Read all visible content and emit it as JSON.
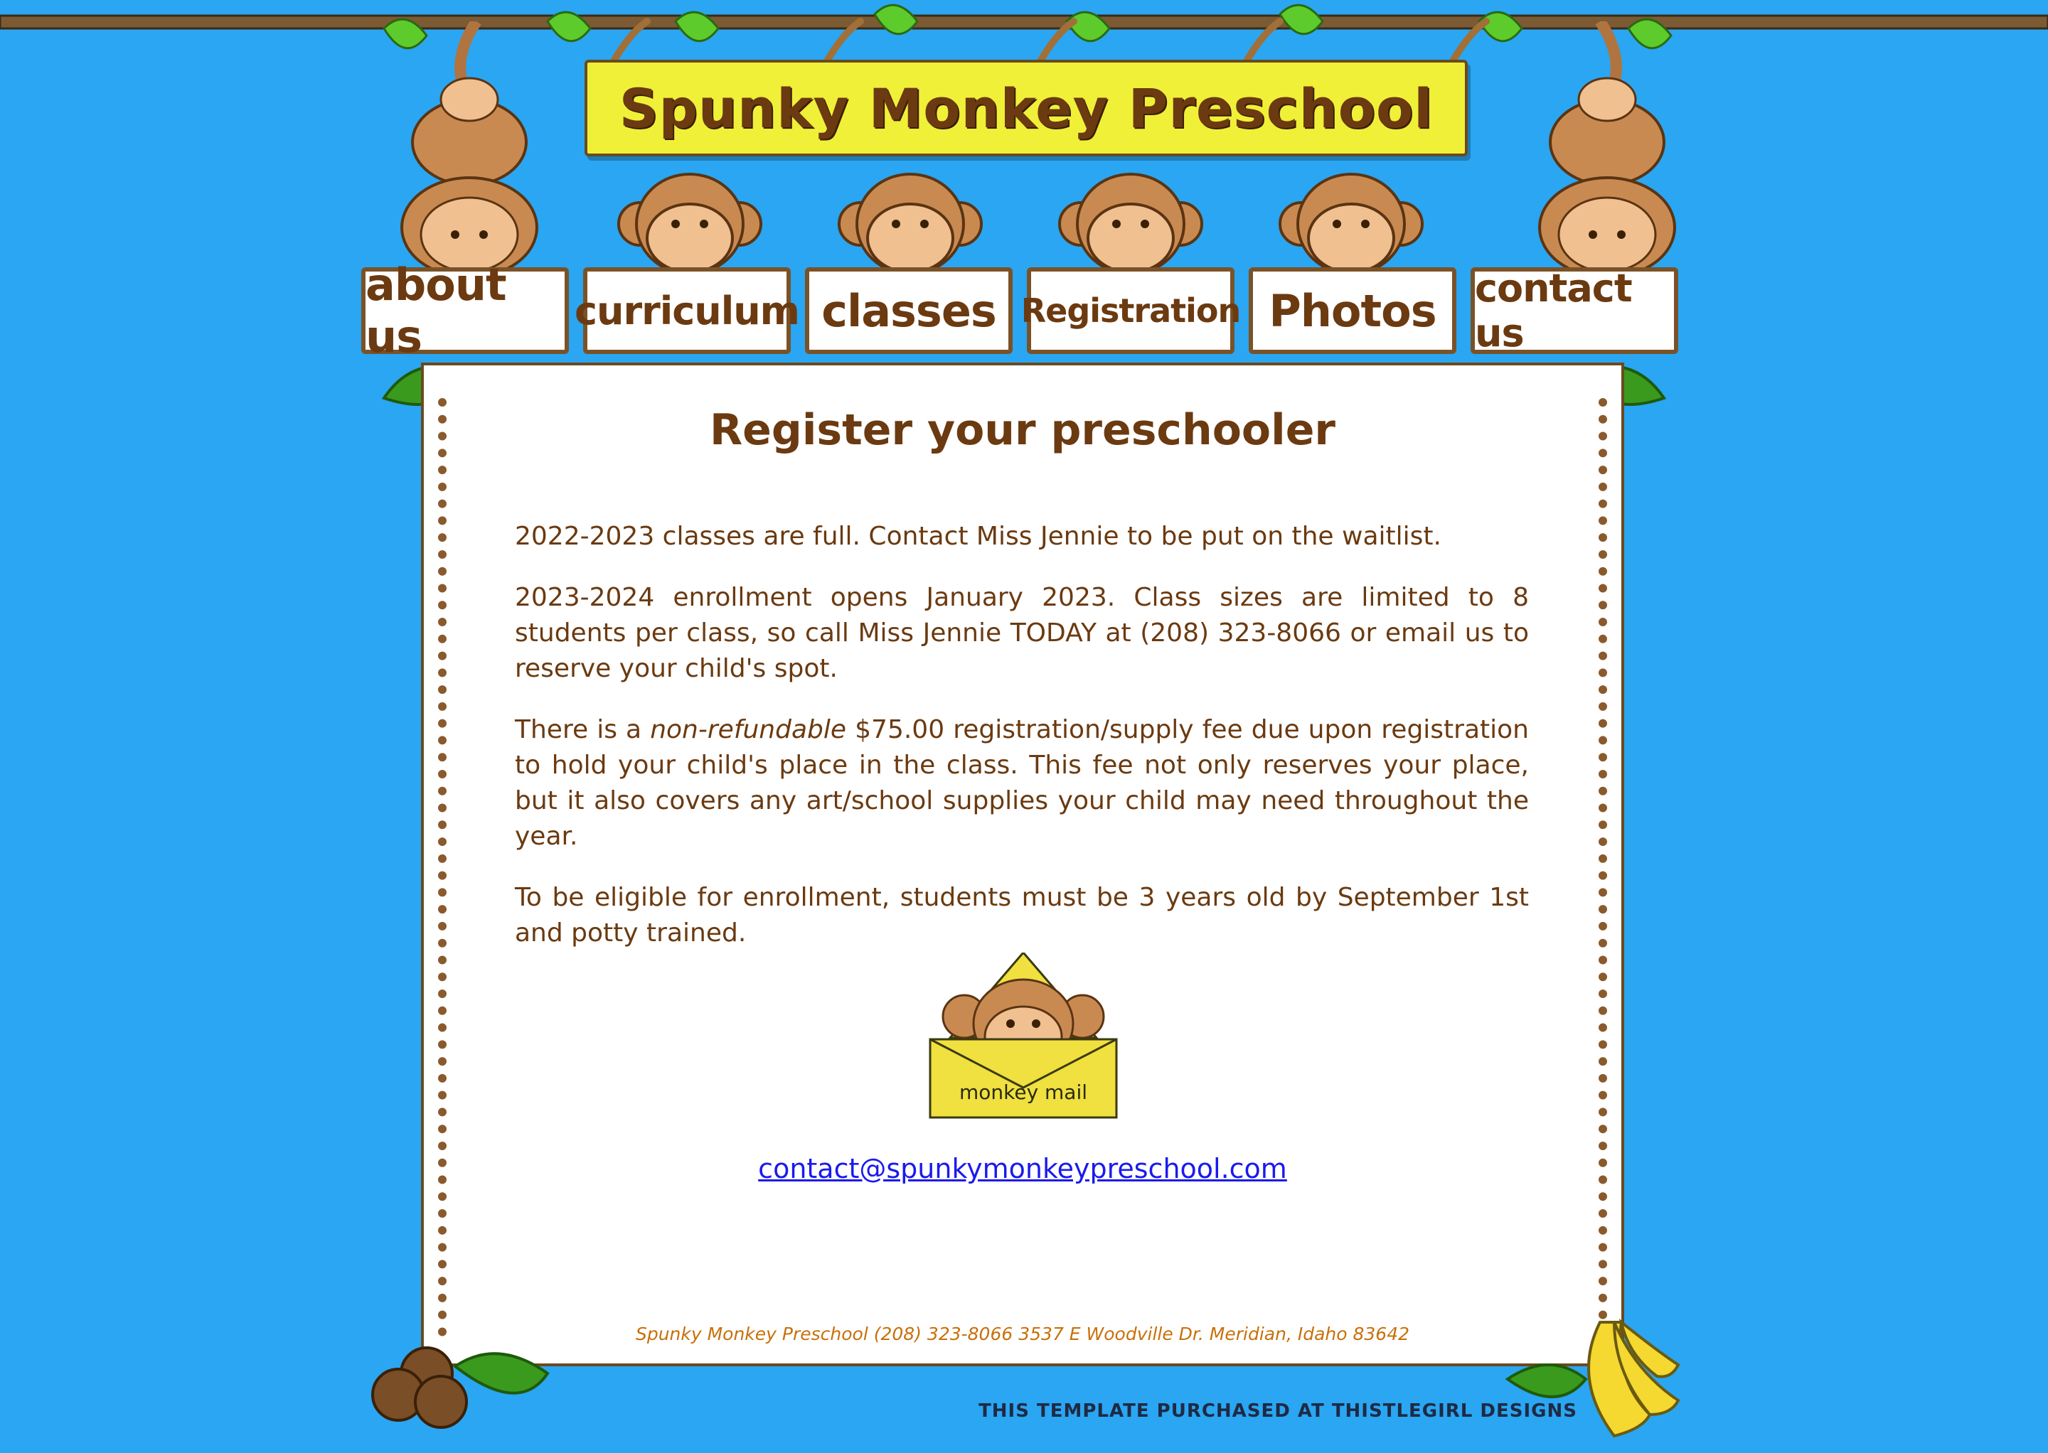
{
  "header": {
    "site_title": "Spunky Monkey Preschool"
  },
  "nav": {
    "items": [
      {
        "label": "about us"
      },
      {
        "label": "curriculum"
      },
      {
        "label": "classes"
      },
      {
        "label": "Registration"
      },
      {
        "label": "Photos"
      },
      {
        "label": "contact us"
      }
    ]
  },
  "main": {
    "title": "Register your preschooler",
    "p1": "2022-2023 classes are full. Contact Miss Jennie to be put on the waitlist.",
    "p2": "2023-2024 enrollment opens January 2023. Class sizes are limited to 8 students per class, so call Miss Jennie TODAY at (208) 323-8066 or email us to reserve your child's spot.",
    "p3_before": "There is a ",
    "p3_em": "non-refundable",
    "p3_after": " $75.00 registration/supply fee due upon registration to hold your child's place in the class. This fee not only reserves your place, but it also covers any art/school supplies your child may need throughout the year.",
    "p4": "To be eligible for enrollment, students must be 3 years old by September 1st and potty trained.",
    "mail_label": "monkey mail",
    "email": "contact@spunkymonkeypreschool.com"
  },
  "footer": {
    "address": "Spunky Monkey Preschool (208) 323-8066 3537 E Woodville Dr. Meridian, Idaho 83642",
    "credit": "THIS TEMPLATE PURCHASED AT THISTLEGIRL DESIGNS"
  },
  "colors": {
    "background": "#2aa6f2",
    "brown_text": "#6b3a10",
    "banner_yellow": "#f0f039",
    "link_blue": "#1a1aee",
    "footer_orange": "#c8700a"
  }
}
